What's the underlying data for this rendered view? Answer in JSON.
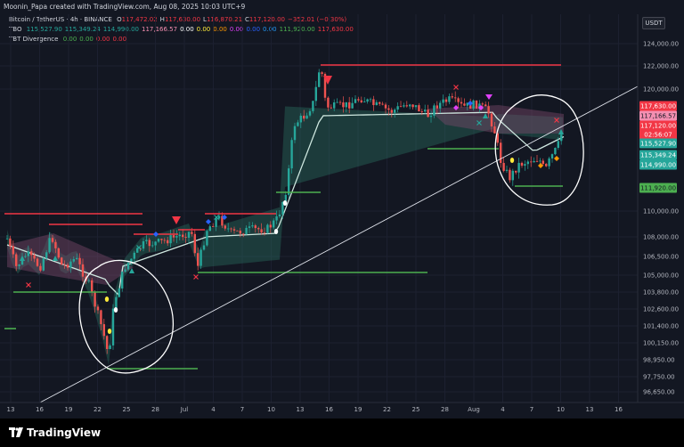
{
  "credit": "Moonin_Papa created with TradingView.com, Aug 08, 2025 10:03 UTC+9",
  "legend": {
    "symbol_line": {
      "name": "Bitcoin / TetherUS · 4h · BINANCE",
      "values": [
        {
          "label": "O",
          "value": "117,472.02"
        },
        {
          "label": "H",
          "value": "117,630.00"
        },
        {
          "label": "L",
          "value": "116,870.21"
        },
        {
          "label": "C",
          "value": "117,120.00"
        },
        {
          "label": "",
          "value": "−352.01 (−0.30%)"
        }
      ]
    },
    "tbo_line": {
      "name": "TBO",
      "values": [
        {
          "value": "115,527.90",
          "color": "#26a69a"
        },
        {
          "value": "115,349.24",
          "color": "#26a69a"
        },
        {
          "value": "114,990.00",
          "color": "#26a69a"
        },
        {
          "value": "117,166.57",
          "color": "#f48fb1"
        },
        {
          "value": "0.00",
          "color": "#ffffff"
        },
        {
          "value": "0.00",
          "color": "#ffeb3b"
        },
        {
          "value": "0.00",
          "color": "#ff9800"
        },
        {
          "value": "0.00",
          "color": "#e040fb"
        },
        {
          "value": "0.00",
          "color": "#2962ff"
        },
        {
          "value": "0.00",
          "color": "#2196f3"
        },
        {
          "value": "111,920.00",
          "color": "#4caf50"
        },
        {
          "value": "117,630.00",
          "color": "#f23645"
        }
      ]
    },
    "tbt_line": {
      "name": "TBT Divergence",
      "values": [
        {
          "value": "0.00",
          "color": "#4caf50"
        },
        {
          "value": "0.00",
          "color": "#4caf50"
        },
        {
          "value": "0.00",
          "color": "#f23645"
        },
        {
          "value": "0.00",
          "color": "#f23645"
        }
      ]
    }
  },
  "currency_label": "USDT",
  "logo_text": "TradingView",
  "chart_data": {
    "type": "line",
    "price_axis": {
      "ticks": [
        "124,000.00",
        "122,000.00",
        "120,000.00",
        "110,000.00",
        "108,000.00",
        "106,500.00",
        "105,000.00",
        "103,800.00",
        "102,600.00",
        "101,400.00",
        "100,150.00",
        "98,950.00",
        "97,750.00",
        "96,650.00"
      ]
    },
    "time_axis": {
      "ticks": [
        "13",
        "16",
        "19",
        "22",
        "25",
        "28",
        "Jul",
        "4",
        "7",
        "10",
        "13",
        "16",
        "19",
        "22",
        "25",
        "28",
        "Aug",
        "4",
        "7",
        "10",
        "13",
        "16"
      ]
    },
    "price_labels": [
      {
        "value": "117,630.00",
        "bg": "#f23645",
        "fg": "#ffffff"
      },
      {
        "value": "117,166.57",
        "bg": "#f48fb1",
        "fg": "#131722"
      },
      {
        "value": "117,120.00",
        "bg": "#f23645",
        "fg": "#ffffff"
      },
      {
        "value": "02:56:07",
        "bg": "#f23645",
        "fg": "#ffffff"
      },
      {
        "value": "115,527.90",
        "bg": "#26a69a",
        "fg": "#ffffff"
      },
      {
        "value": "115,349.24",
        "bg": "#26a69a",
        "fg": "#ffffff"
      },
      {
        "value": "114,990.00",
        "bg": "#26a69a",
        "fg": "#ffffff"
      },
      {
        "value": "111,920.00",
        "bg": "#4caf50",
        "fg": "#131722"
      }
    ],
    "colors": {
      "up": "#26a69a",
      "down": "#ef5350",
      "resistance": "#f23645",
      "support": "#4caf50",
      "band": "#2e7d6b",
      "band_bear": "#7b4a6b"
    },
    "grid": true,
    "legend_position": "top-left"
  }
}
